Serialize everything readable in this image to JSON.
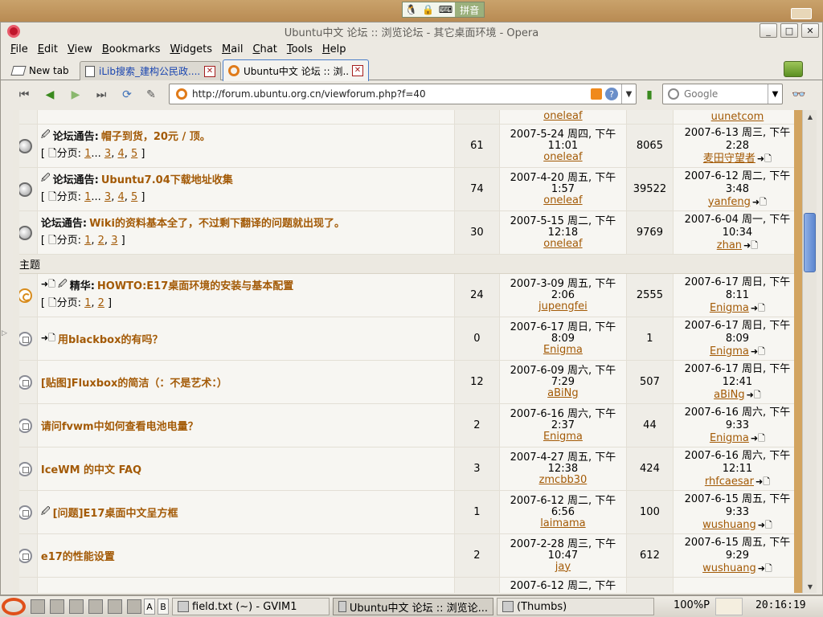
{
  "desktop": {
    "ime_label": "拼音"
  },
  "window": {
    "title": "Ubuntu中文 论坛 :: 浏览论坛 - 其它桌面环境 - Opera",
    "controls": {
      "minimize": "_",
      "maximize": "□",
      "close": "✕"
    }
  },
  "menu": [
    "File",
    "Edit",
    "View",
    "Bookmarks",
    "Widgets",
    "Mail",
    "Chat",
    "Tools",
    "Help"
  ],
  "tabs": {
    "new_tab": "New tab",
    "items": [
      {
        "title": "iLib搜索_建构公民政......"
      },
      {
        "title": "Ubuntu中文 论坛 :: 浏..."
      }
    ]
  },
  "address": {
    "url": "http://forum.ubuntu.org.cn/viewforum.php?f=40",
    "search_placeholder": "Google"
  },
  "forum": {
    "section_label": "主题",
    "partial_top": {
      "author": "oneleaf",
      "last_user": "uunetcom"
    },
    "announcements": [
      {
        "prefix": "论坛通告:",
        "pin": true,
        "title": "帽子到货，20元 / 顶。",
        "pages_label": "分页:",
        "pages": [
          "1",
          "...",
          "3",
          "4",
          "5"
        ],
        "replies": "61",
        "date": "2007-5-24 周四, 下午",
        "time": "11:01",
        "author": "oneleaf",
        "views": "8065",
        "last_date": "2007-6-13 周三, 下午2:28",
        "last_user": "麦田守望者"
      },
      {
        "prefix": "论坛通告:",
        "pin": true,
        "title": "Ubuntu7.04下载地址收集",
        "pages_label": "分页:",
        "pages": [
          "1",
          "...",
          "3",
          "4",
          "5"
        ],
        "replies": "74",
        "date": "2007-4-20 周五, 下午",
        "time": "1:57",
        "author": "oneleaf",
        "views": "39522",
        "last_date": "2007-6-12 周二, 下午3:48",
        "last_user": "yanfeng"
      },
      {
        "prefix": "论坛通告:",
        "pin": false,
        "title": "Wiki的资料基本全了，不过剩下翻译的问题就出现了。",
        "pages_label": "分页:",
        "pages": [
          "1",
          "2",
          "3"
        ],
        "replies": "30",
        "date": "2007-5-15 周二, 下午",
        "time": "12:18",
        "author": "oneleaf",
        "views": "9769",
        "last_date": "2007-6-04 周一, 下午10:34",
        "last_user": "zhan"
      }
    ],
    "topics": [
      {
        "icon": "hot",
        "prefix": "精华:",
        "arrow": true,
        "pin": true,
        "title": "HOWTO:E17桌面环境的安装与基本配置",
        "pages_label": "分页:",
        "pages": [
          "1",
          "2"
        ],
        "replies": "24",
        "date": "2007-3-09 周五, 下午",
        "time": "2:06",
        "author": "jupengfei",
        "views": "2555",
        "last_date": "2007-6-17 周日, 下午8:11",
        "last_user": "Enigma"
      },
      {
        "icon": "new",
        "prefix": "",
        "arrow": true,
        "pin": false,
        "title": "用blackbox的有吗？",
        "pages_label": "",
        "pages": [],
        "replies": "0",
        "date": "2007-6-17 周日, 下午",
        "time": "8:09",
        "author": "Enigma",
        "views": "1",
        "last_date": "2007-6-17 周日, 下午8:09",
        "last_user": "Enigma"
      },
      {
        "icon": "normal",
        "prefix": "",
        "arrow": false,
        "pin": false,
        "title": "[贴图]Fluxbox的简洁（：不是艺术：）",
        "pages_label": "",
        "pages": [],
        "replies": "12",
        "date": "2007-6-09 周六, 下午",
        "time": "7:29",
        "author": "aBiNg",
        "views": "507",
        "last_date": "2007-6-17 周日, 下午12:41",
        "last_user": "aBiNg"
      },
      {
        "icon": "normal",
        "prefix": "",
        "arrow": false,
        "pin": false,
        "title": "请问fvwm中如何查看电池电量？",
        "pages_label": "",
        "pages": [],
        "replies": "2",
        "date": "2007-6-16 周六, 下午",
        "time": "2:37",
        "author": "Enigma",
        "views": "44",
        "last_date": "2007-6-16 周六, 下午9:33",
        "last_user": "Enigma"
      },
      {
        "icon": "normal",
        "prefix": "",
        "arrow": false,
        "pin": false,
        "title": "IceWM 的中文 FAQ",
        "pages_label": "",
        "pages": [],
        "replies": "3",
        "date": "2007-4-27 周五, 下午",
        "time": "12:38",
        "author": "zmcbb30",
        "views": "424",
        "last_date": "2007-6-16 周六, 下午12:11",
        "last_user": "rhfcaesar"
      },
      {
        "icon": "normal",
        "prefix": "",
        "arrow": false,
        "pin": true,
        "title": "[问题]E17桌面中文呈方框",
        "pages_label": "",
        "pages": [],
        "replies": "1",
        "date": "2007-6-12 周二, 下午",
        "time": "6:56",
        "author": "laimama",
        "views": "100",
        "last_date": "2007-6-15 周五, 下午9:33",
        "last_user": "wushuang"
      },
      {
        "icon": "normal",
        "prefix": "",
        "arrow": false,
        "pin": false,
        "title": "e17的性能设置",
        "pages_label": "",
        "pages": [],
        "replies": "2",
        "date": "2007-2-28 周三, 下午",
        "time": "10:47",
        "author": "jay",
        "views": "612",
        "last_date": "2007-6-15 周五, 下午9:29",
        "last_user": "wushuang"
      }
    ],
    "partial_bottom": {
      "date": "2007-6-12 周二, 下午"
    }
  },
  "scrollbar": {
    "position_fraction": 0.1
  },
  "taskbar": {
    "letters": [
      "A",
      "B"
    ],
    "tasks": [
      "field.txt (~) - GVIM1",
      "Ubuntu中文 论坛 :: 浏览论...",
      "(Thumbs)"
    ],
    "zoom": "100%P",
    "clock": "20:16:19"
  }
}
